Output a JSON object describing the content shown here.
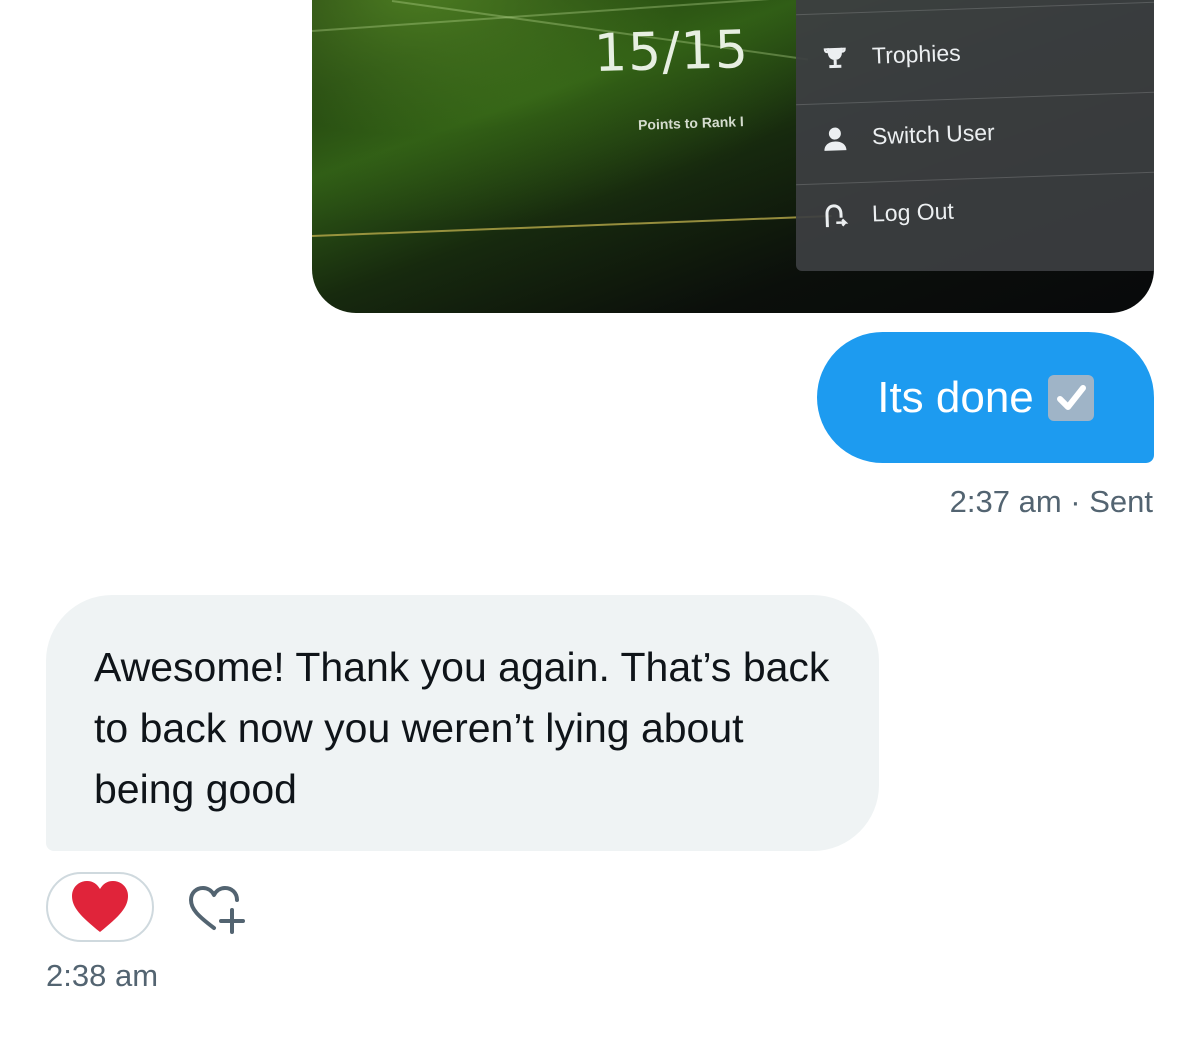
{
  "photo": {
    "score": "15/15",
    "points_label": "Points to Rank I",
    "menu": [
      {
        "label": "Trophies",
        "icon": "trophy-icon"
      },
      {
        "label": "Switch User",
        "icon": "user-icon"
      },
      {
        "label": "Log Out",
        "icon": "logout-icon"
      }
    ]
  },
  "sent_message": {
    "text": "Its done",
    "emoji": "check-box-icon",
    "time": "2:37 am",
    "status": "Sent",
    "separator": "·",
    "color": "#1d9bf0"
  },
  "received_message": {
    "text": "Awesome! Thank you again. That’s back to back now you weren’t lying about being good",
    "time": "2:38 am",
    "reaction": "heart-icon",
    "add_reaction": "add-reaction-icon",
    "bubble_color": "#eff3f4"
  },
  "colors": {
    "accent": "#1d9bf0",
    "meta_text": "#536471",
    "heart": "#e0243a"
  }
}
